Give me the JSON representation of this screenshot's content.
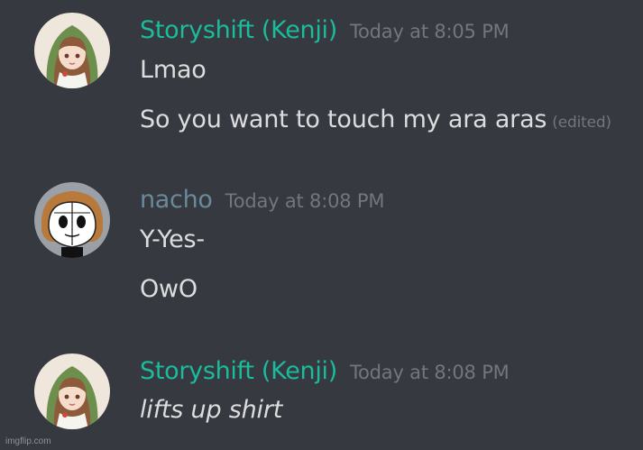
{
  "colors": {
    "background": "#36393f",
    "kenji_name": "#1abc9c",
    "nacho_name": "#6a8a99",
    "timestamp": "#72767d",
    "message_text": "#dcddde"
  },
  "messages": [
    {
      "author": "Storyshift (Kenji)",
      "timestamp": "Today at 8:05 PM",
      "avatar_icon": "green-hood-girl-avatar",
      "lines": [
        "Lmao",
        "So you want to touch my ara aras"
      ],
      "edited_label": "(edited)"
    },
    {
      "author": "nacho",
      "timestamp": "Today at 8:08 PM",
      "avatar_icon": "cartoon-face-avatar",
      "lines": [
        "Y-Yes-",
        "OwO"
      ]
    },
    {
      "author": "Storyshift (Kenji)",
      "timestamp": "Today at 8:08 PM",
      "avatar_icon": "green-hood-girl-avatar",
      "lines": [
        "lifts up shirt"
      ]
    }
  ],
  "watermark": "imgflip.com"
}
